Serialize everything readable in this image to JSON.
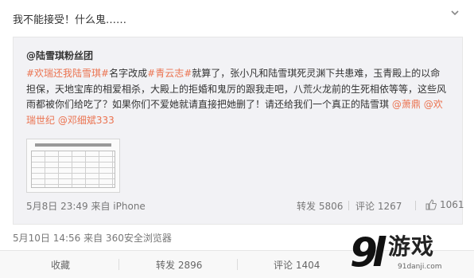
{
  "post": {
    "text": "我不能接受！什么鬼……",
    "meta": "5月10日 14:56 来自 360安全浏览器"
  },
  "repost": {
    "author": "@陆雪琪粉丝团",
    "body": {
      "tag1": "#欢瑞还我陆雪琪#",
      "t1": "名字改成",
      "tag2": "#青云志#",
      "t2": "就算了，张小凡和陆雪琪死灵渊下共患难，玉青殿上的以命担保，天地宝库的相爱相杀，大殿上的拒婚和鬼厉的跟我走吧，八荒火龙前的生死相依等等，这些风雨都被你们给吃了？如果你们不爱她就请直接把她删了！请还给我们一个真正的陆雪琪",
      "m1": "@萧鼎",
      "m2": "@欢瑞世纪",
      "m3": "@邓细斌333"
    },
    "meta": "5月8日 23:49 来自 iPhone",
    "forward": "转发 5806",
    "comment": "评论 1267",
    "likes": "1061"
  },
  "actions": {
    "favorite": "收藏",
    "forward": "转发 2896",
    "comment": "评论 1404"
  },
  "watermark": {
    "logo": "游戏",
    "url": "91danji.com"
  },
  "colors": {
    "accent": "#eb7350",
    "repost_bg": "#f2f2f5"
  }
}
